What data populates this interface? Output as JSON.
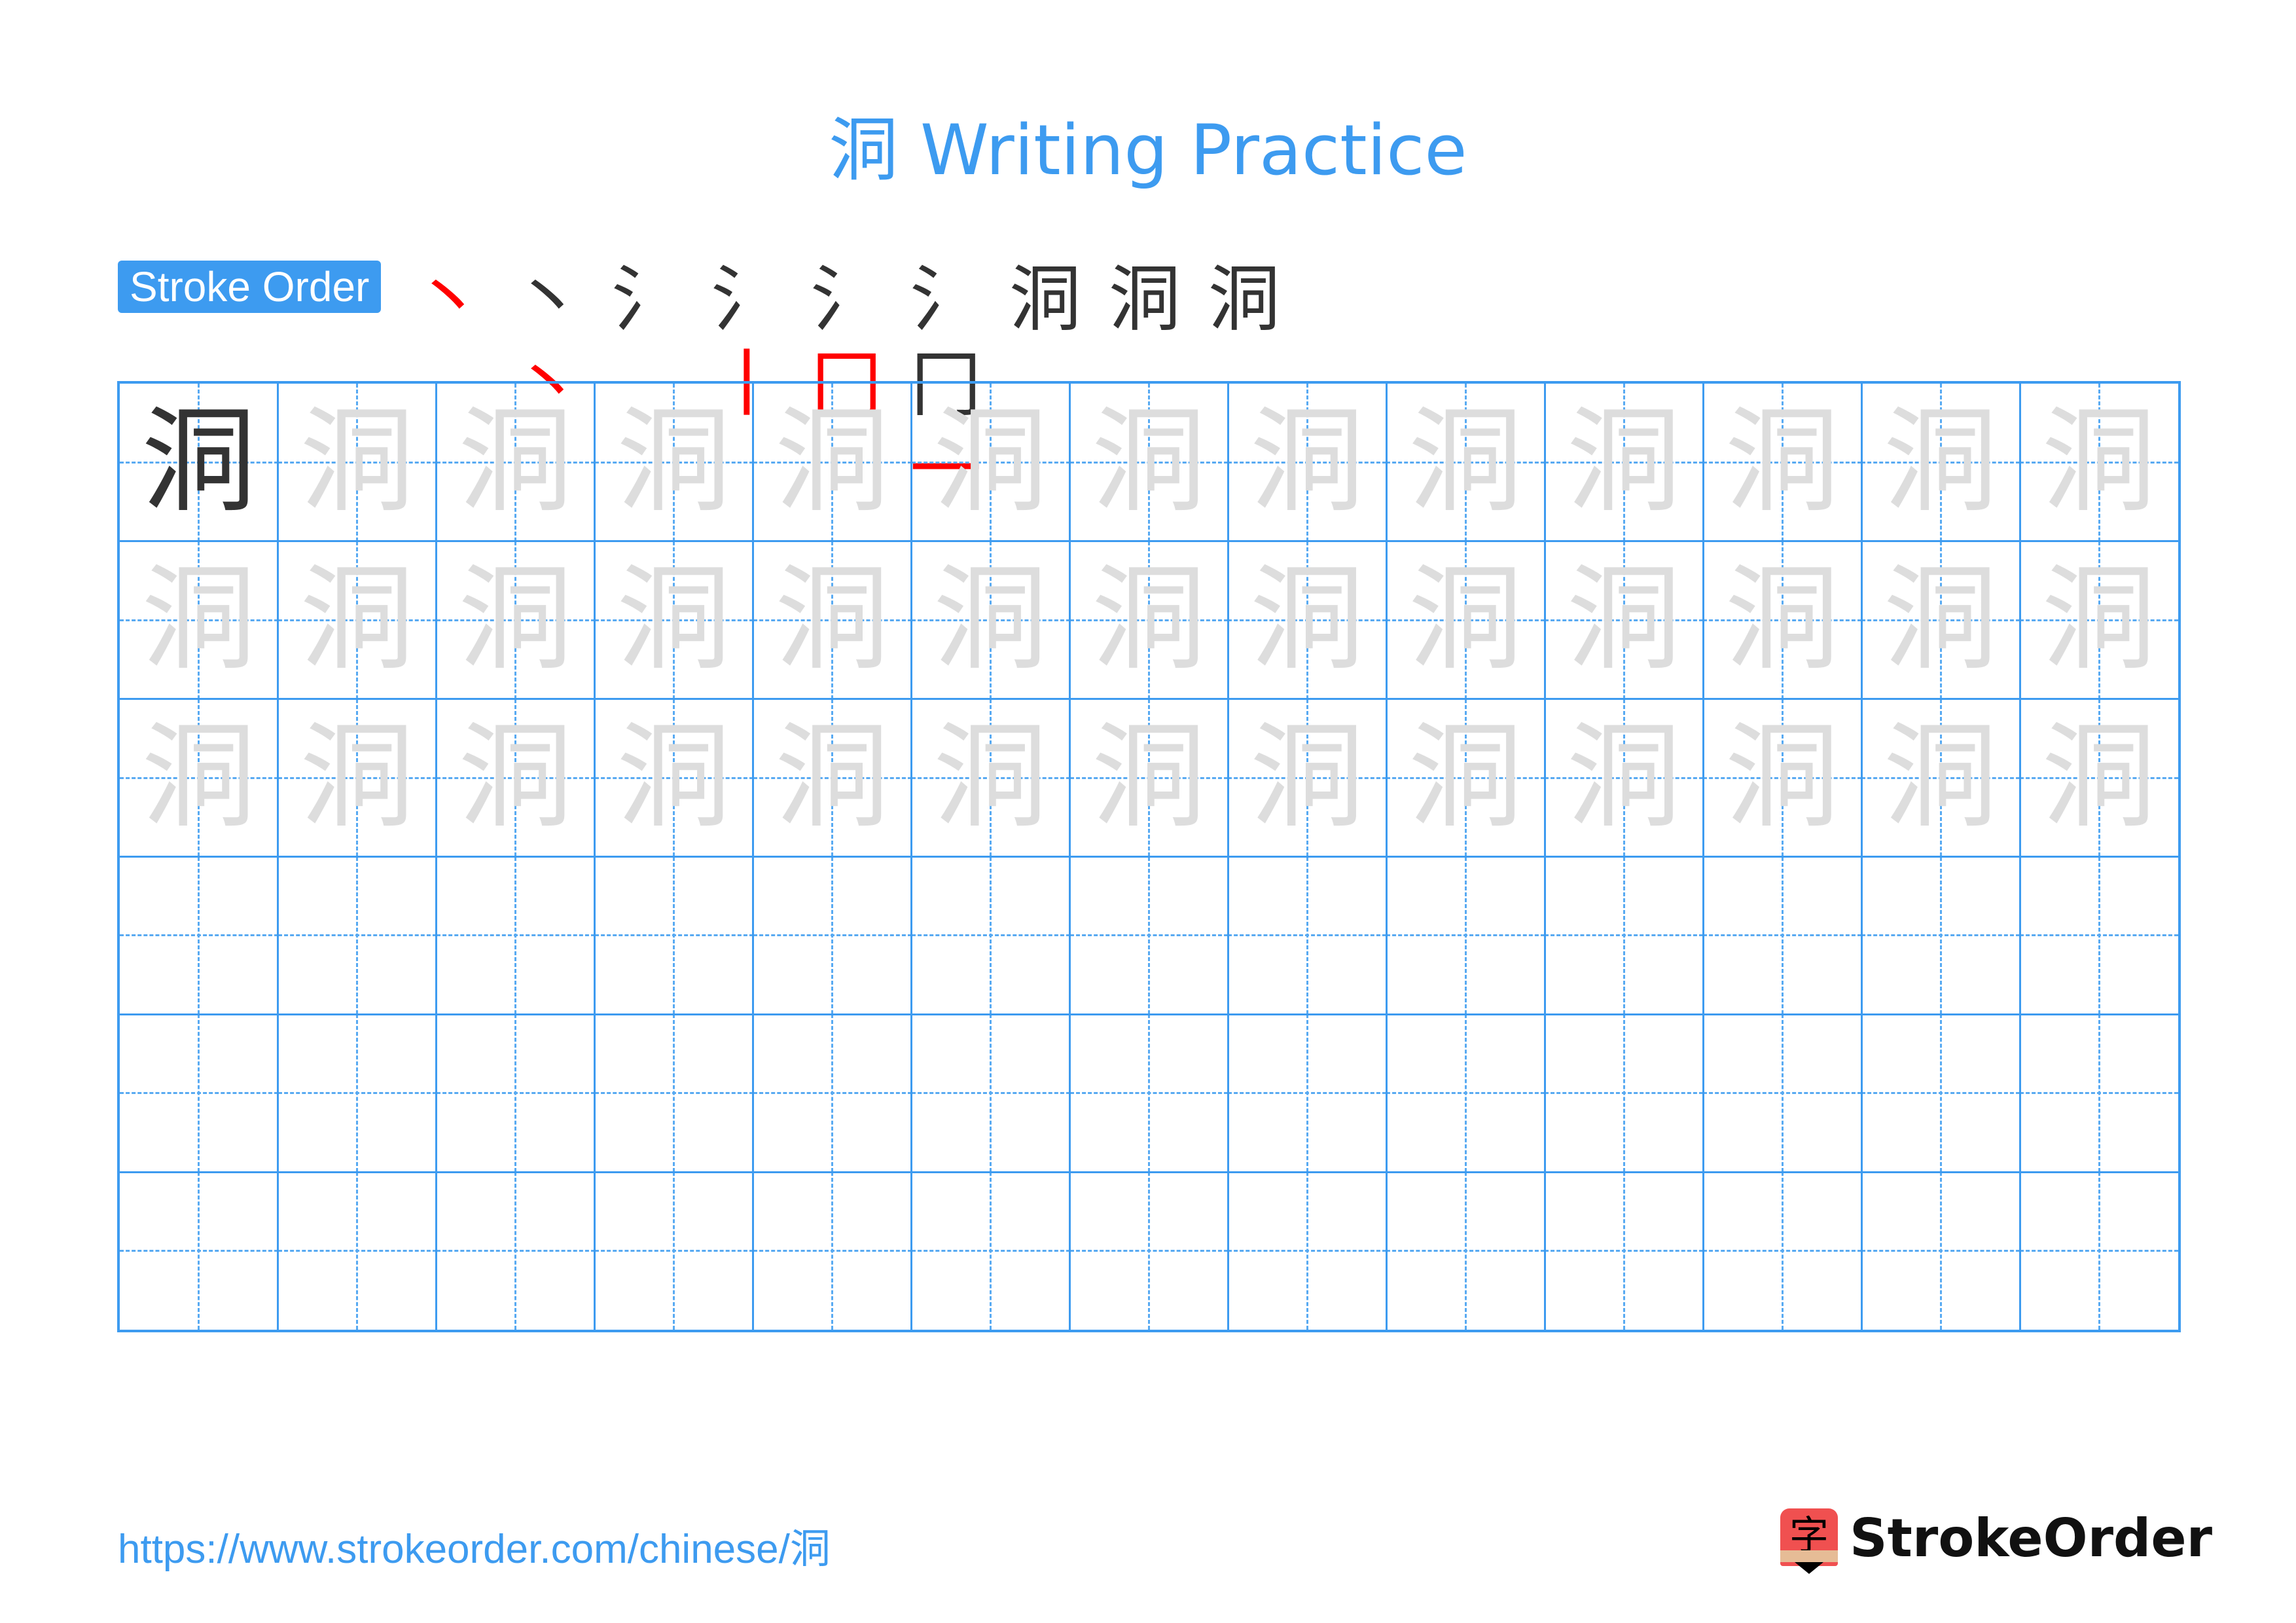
{
  "title": "洞 Writing Practice",
  "character": "洞",
  "stroke_order": {
    "label": "Stroke Order",
    "steps": [
      {
        "done": "",
        "new": "丶"
      },
      {
        "done": "丶",
        "new": "丶"
      },
      {
        "done": "氵",
        "new": ""
      },
      {
        "done": "氵",
        "new": "丨"
      },
      {
        "done": "氵",
        "new": "冂"
      },
      {
        "done": "氵冂",
        "new": "一"
      },
      {
        "done": "洞",
        "new": ""
      },
      {
        "done": "洞",
        "new": ""
      },
      {
        "done": "洞",
        "new": ""
      }
    ]
  },
  "grid": {
    "columns": 13,
    "rows": 6,
    "solid_cells": 1,
    "trace_rows": 3,
    "line_color": "#3d9bf0",
    "trace_color": "#dddddd",
    "solid_color": "#333333"
  },
  "footer": {
    "url": "https://www.strokeorder.com/chinese/洞",
    "brand_icon_char": "字",
    "brand_name": "StrokeOrder"
  }
}
